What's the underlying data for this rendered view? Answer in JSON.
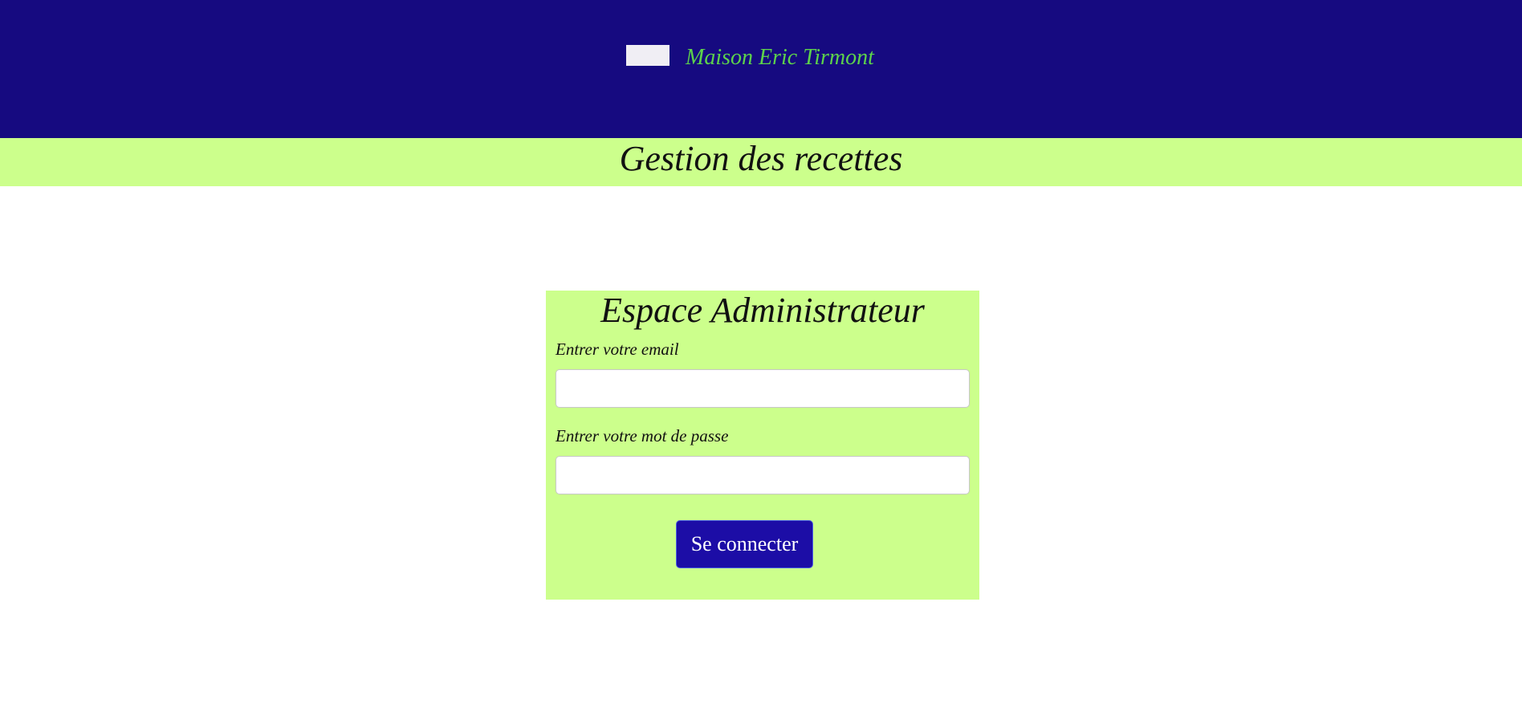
{
  "header": {
    "brand": "Maison Eric Tirmont",
    "logo_icon": "logo-placeholder-icon",
    "background_color": "#160a80",
    "brand_color": "#5dd24b"
  },
  "subheader": {
    "title": "Gestion des recettes",
    "background_color": "#ccff8c"
  },
  "login_form": {
    "title": "Espace Administrateur",
    "email_label": "Entrer votre email",
    "email_value": "",
    "password_label": "Entrer votre mot de passe",
    "password_value": "",
    "submit_label": "Se connecter",
    "button_color": "#1c0da6"
  }
}
